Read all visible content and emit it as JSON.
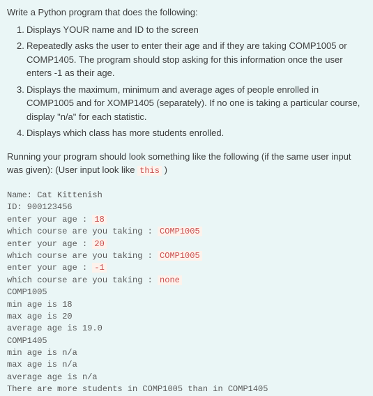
{
  "intro": "Write a Python program that does the following:",
  "items": [
    {
      "num": "1.",
      "text": "Displays YOUR name and ID to the screen"
    },
    {
      "num": "2.",
      "text": "Repeatedly asks the user to enter their age and if they are taking COMP1005 or COMP1405. The program should stop asking for this information once the user enters -1 as their age."
    },
    {
      "num": "3.",
      "text": "Displays the maximum, minimum and average ages of people enrolled in COMP1005 and for XOMP1405 (separately). If no one is taking a particular course, display \"n/a\" for each statistic."
    },
    {
      "num": "4.",
      "text": "Displays which class has more students enrolled."
    }
  ],
  "running_caption_prefix": "Running your program should look something like the following (if the same user input was given): (User input look like ",
  "running_caption_highlight": "this",
  "running_caption_suffix": " )",
  "console": {
    "name_line": "Name: Cat Kittenish",
    "id_line": "ID: 900123456",
    "age_prompt": "enter your age : ",
    "course_prompt": "which course are you taking : ",
    "inputs": {
      "age1": "18",
      "course1": "COMP1005",
      "age2": "20",
      "course2": "COMP1005",
      "age3": "-1",
      "course3": "none"
    },
    "section1_header": "COMP1005",
    "s1_min": "min age is 18",
    "s1_max": "max age is 20",
    "s1_avg": "average age is 19.0",
    "section2_header": "COMP1405",
    "s2_min": "min age is n/a",
    "s2_max": "max age is n/a",
    "s2_avg": "average age is n/a",
    "final_line": "There are more students in COMP1005 than in COMP1405"
  }
}
